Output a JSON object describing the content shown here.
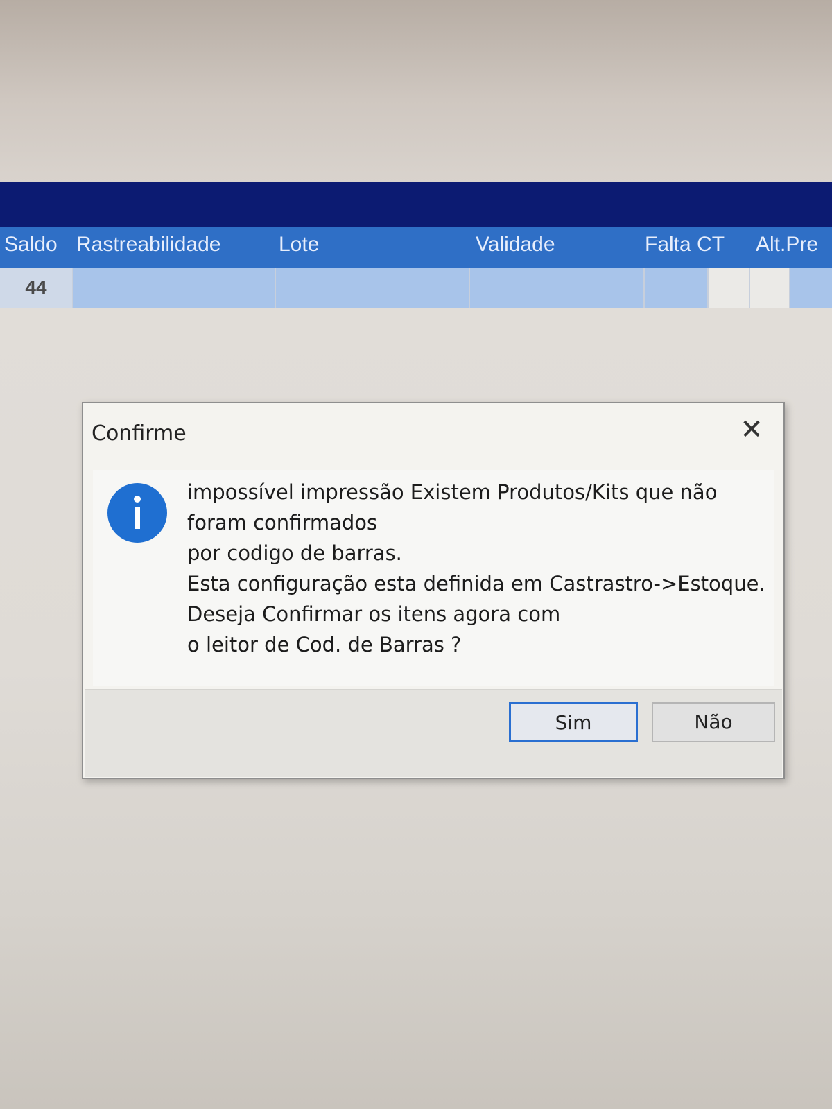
{
  "grid": {
    "columns": [
      "Saldo",
      "Rastreabilidade",
      "Lote",
      "Validade",
      "Falta CT",
      "Alt.Pre"
    ],
    "row": {
      "saldo": "44"
    }
  },
  "dialog": {
    "title": "Confirme",
    "close_symbol": "✕",
    "icon": "info-icon",
    "message": "impossível impressão Existem Produtos/Kits que não\nforam confirmados\npor codigo de barras.\nEsta configuração esta definida em Castrastro->Estoque.\nDeseja Confirmar os itens agora com\no leitor de Cod. de Barras ?",
    "buttons": {
      "yes": "Sim",
      "no": "Não"
    }
  },
  "colors": {
    "title_strip": "#0c1b72",
    "grid_header": "#2f6fc6",
    "info_icon": "#1f6fd1",
    "focused_button_border": "#2a6fd1"
  }
}
